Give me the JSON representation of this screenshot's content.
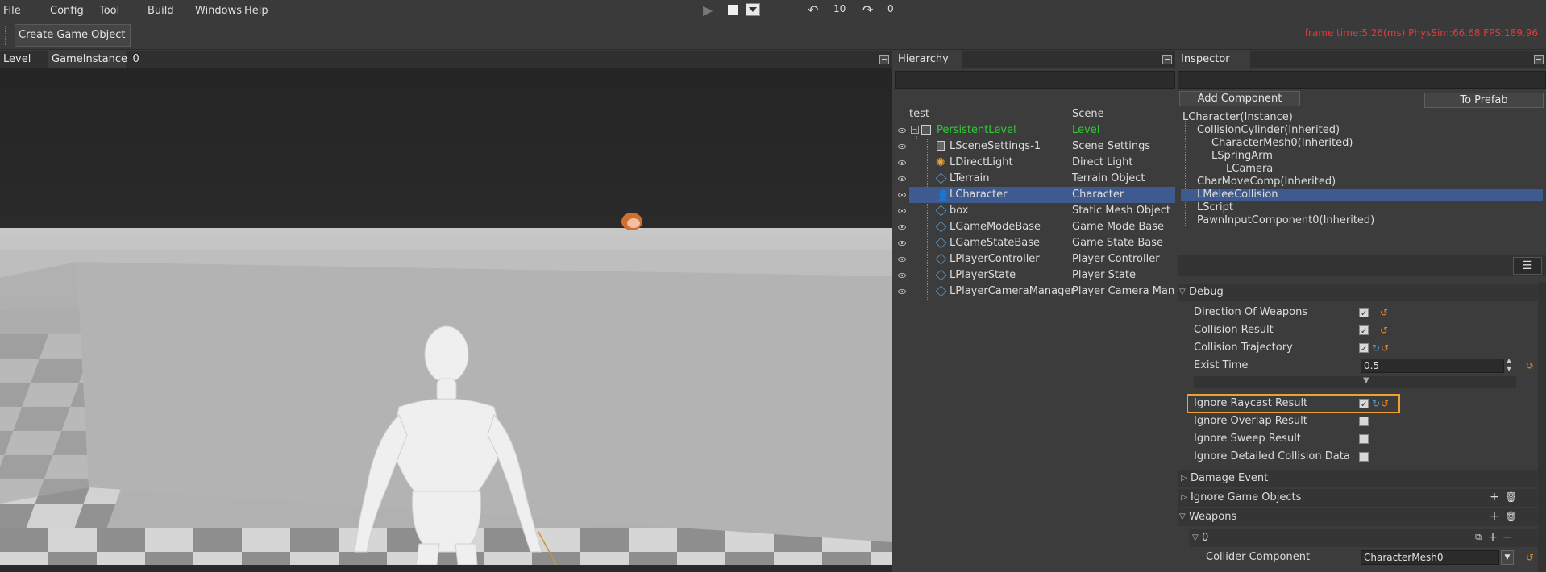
{
  "menu": [
    "File",
    "Config",
    "Tool",
    "Build",
    "Windows",
    "Help"
  ],
  "toolbar": {
    "undo_count": "10",
    "redo_count": "0",
    "create_label": "Create Game Object",
    "stats": "frame time:5.26(ms)   PhysSim:66.68   FPS:189.96"
  },
  "viewport": {
    "tabs": [
      "Level",
      "GameInstance_0"
    ]
  },
  "hierarchy": {
    "title": "Hierarchy",
    "header": {
      "name": "test",
      "type": "Scene"
    },
    "rows": [
      {
        "name": "PersistentLevel",
        "type": "Level",
        "icon": "level-icon",
        "green": true
      },
      {
        "name": "LSceneSettings-1",
        "type": "Scene Settings",
        "icon": "settings-icon"
      },
      {
        "name": "LDirectLight",
        "type": "Direct Light",
        "icon": "sun-icon"
      },
      {
        "name": "LTerrain",
        "type": "Terrain Object",
        "icon": "cube-icon"
      },
      {
        "name": "LCharacter",
        "type": "Character",
        "icon": "person-icon",
        "selected": true
      },
      {
        "name": "box",
        "type": "Static Mesh Object",
        "icon": "cube-icon"
      },
      {
        "name": "LGameModeBase",
        "type": "Game Mode Base",
        "icon": "cube-icon"
      },
      {
        "name": "LGameStateBase",
        "type": "Game State Base",
        "icon": "cube-icon"
      },
      {
        "name": "LPlayerController",
        "type": "Player Controller",
        "icon": "cube-icon"
      },
      {
        "name": "LPlayerState",
        "type": "Player State",
        "icon": "cube-icon"
      },
      {
        "name": "LPlayerCameraManager",
        "type": "Player Camera Manag",
        "icon": "cube-icon"
      }
    ]
  },
  "inspector": {
    "title": "Inspector",
    "add_component": "Add Component",
    "to_prefab": "To Prefab",
    "components": [
      {
        "name": "LCharacter(Instance)"
      },
      {
        "name": "CollisionCylinder(Inherited)"
      },
      {
        "name": "CharacterMesh0(Inherited)"
      },
      {
        "name": "LSpringArm"
      },
      {
        "name": "LCamera"
      },
      {
        "name": "CharMoveComp(Inherited)"
      },
      {
        "name": "LMeleeCollision",
        "selected": true
      },
      {
        "name": "LScript"
      },
      {
        "name": "PawnInputComponent0(Inherited)"
      }
    ],
    "sections": {
      "debug": "Debug",
      "damage_event": "Damage Event",
      "ignore_game_objects": "Ignore Game Objects",
      "weapons": "Weapons",
      "weapon_index": "0"
    },
    "props": {
      "direction_of_weapons": {
        "label": "Direction Of Weapons",
        "checked": true
      },
      "collision_result": {
        "label": "Collision Result",
        "checked": true
      },
      "collision_trajectory": {
        "label": "Collision Trajectory",
        "checked": true
      },
      "exist_time": {
        "label": "Exist Time",
        "value": "0.5"
      },
      "ignore_raycast_result": {
        "label": "Ignore Raycast Result",
        "checked": true
      },
      "ignore_overlap_result": {
        "label": "Ignore Overlap Result",
        "checked": false
      },
      "ignore_sweep_result": {
        "label": "Ignore Sweep Result",
        "checked": false
      },
      "ignore_detailed_collision_data": {
        "label": "Ignore Detailed Collision Data",
        "checked": false
      },
      "collider_component": {
        "label": "Collider Component",
        "value": "CharacterMesh0"
      }
    }
  },
  "colors": {
    "accent_selection": "#3f5a8e",
    "highlight_box": "#f0a030",
    "stats_red": "#e23a3a",
    "level_green": "#2ecc2e"
  }
}
